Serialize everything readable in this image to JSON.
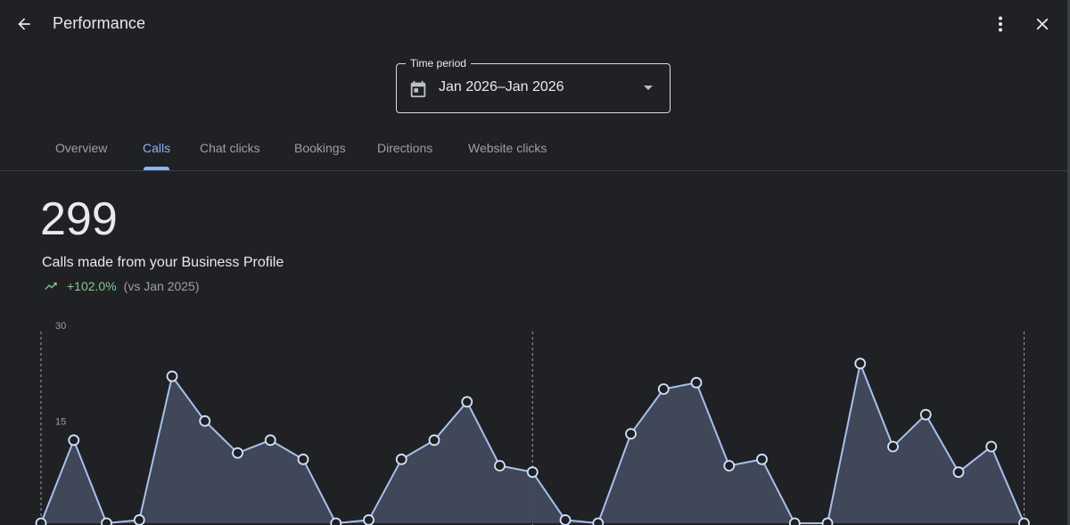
{
  "header": {
    "title": "Performance"
  },
  "time_period": {
    "label": "Time period",
    "value": "Jan 2026–Jan 2026"
  },
  "tabs": [
    {
      "label": "Overview",
      "active": false
    },
    {
      "label": "Calls",
      "active": true
    },
    {
      "label": "Chat clicks",
      "active": false
    },
    {
      "label": "Bookings",
      "active": false
    },
    {
      "label": "Directions",
      "active": false
    },
    {
      "label": "Website clicks",
      "active": false
    }
  ],
  "metric": {
    "value": "299",
    "description": "Calls made from your Business Profile",
    "change": "+102.0%",
    "comparison": "(vs Jan 2025)"
  },
  "colors": {
    "background": "#202124",
    "accent": "#8ab4f8",
    "positive": "#81c995",
    "line": "#a8c0ef",
    "area": "#414a5c"
  },
  "icons": {
    "back": "arrow-left-icon",
    "more": "more-vert-icon",
    "close": "close-icon",
    "calendar": "calendar-icon",
    "dropdown": "dropdown-caret-icon",
    "trend": "trending-up-icon"
  },
  "chart_data": {
    "type": "area",
    "yticks": [
      15,
      30
    ],
    "ylim": [
      0,
      30
    ],
    "grid": false,
    "values": [
      0,
      13,
      0,
      0.5,
      23,
      16,
      11,
      13,
      10,
      0,
      0.5,
      10,
      13,
      19,
      9,
      8,
      0.5,
      0,
      14,
      21,
      22,
      9,
      10,
      0,
      0,
      25,
      12,
      17,
      8,
      12,
      0
    ]
  }
}
